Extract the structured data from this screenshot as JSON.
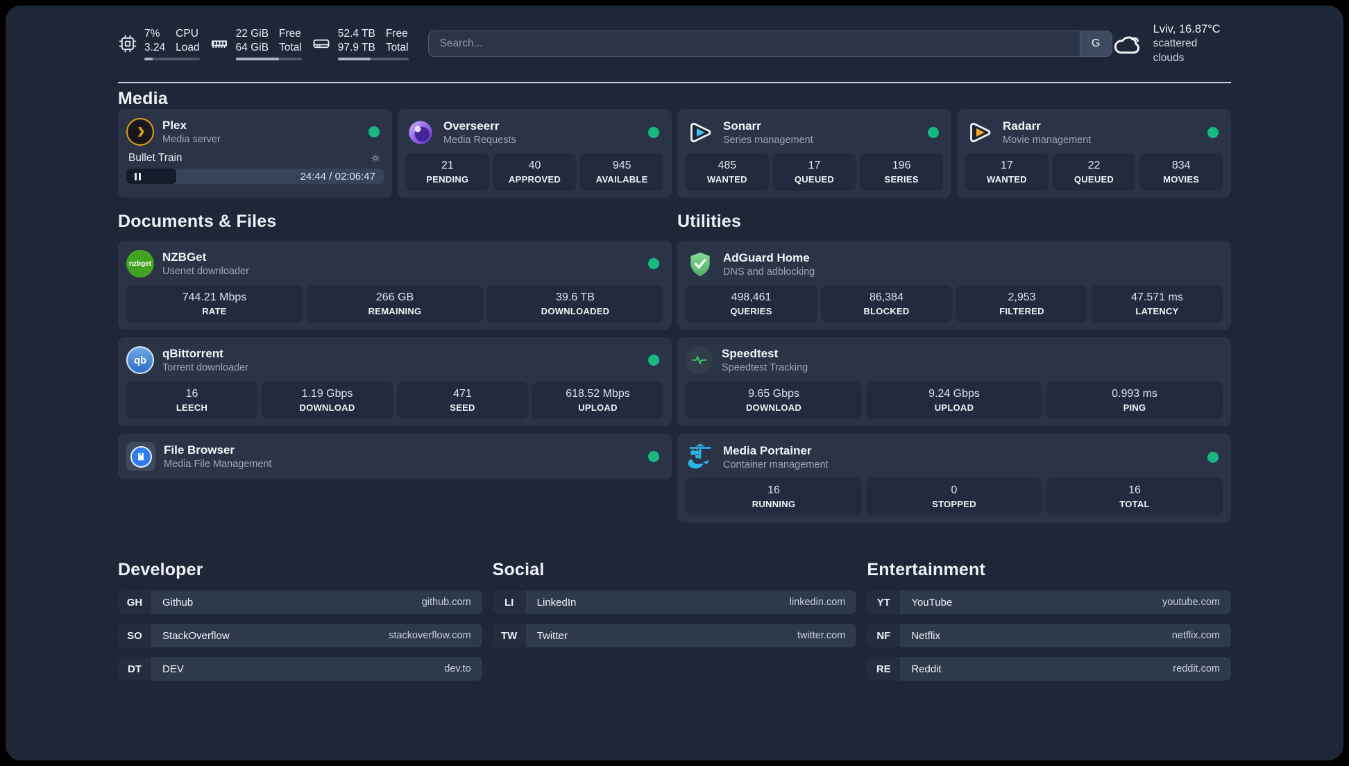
{
  "topbar": {
    "system_stats": [
      {
        "icon": "cpu-icon",
        "values": [
          "7%",
          "3.24"
        ],
        "labels": [
          "CPU",
          "Load"
        ],
        "progress_pct": 15
      },
      {
        "icon": "memory-icon",
        "values": [
          "22 GiB",
          "64 GiB"
        ],
        "labels": [
          "Free",
          "Total"
        ],
        "progress_pct": 66
      },
      {
        "icon": "storage-icon",
        "values": [
          "52.4 TB",
          "97.9 TB"
        ],
        "labels": [
          "Free",
          "Total"
        ],
        "progress_pct": 46
      }
    ],
    "search": {
      "placeholder": "Search...",
      "engine_button_label": "G"
    },
    "weather": {
      "icon": "cloud-icon",
      "location_temperature": "Lviv, 16.87°C",
      "condition": "scattered clouds"
    }
  },
  "media": {
    "heading": "Media",
    "apps": [
      {
        "icon": "plex-icon",
        "name": "Plex",
        "description": "Media server",
        "status": "online",
        "now_playing": {
          "title": "Bullet Train",
          "time": "24:44 / 02:06:47",
          "progress_pct": 19.5
        }
      },
      {
        "icon": "overseerr-icon",
        "name": "Overseerr",
        "description": "Media Requests",
        "status": "online",
        "stats": [
          {
            "value": "21",
            "label": "PENDING"
          },
          {
            "value": "40",
            "label": "APPROVED"
          },
          {
            "value": "945",
            "label": "AVAILABLE"
          }
        ]
      },
      {
        "icon": "sonarr-icon",
        "name": "Sonarr",
        "description": "Series management",
        "status": "online",
        "stats": [
          {
            "value": "485",
            "label": "WANTED"
          },
          {
            "value": "17",
            "label": "QUEUED"
          },
          {
            "value": "196",
            "label": "SERIES"
          }
        ]
      },
      {
        "icon": "radarr-icon",
        "name": "Radarr",
        "description": "Movie management",
        "status": "online",
        "stats": [
          {
            "value": "17",
            "label": "WANTED"
          },
          {
            "value": "22",
            "label": "QUEUED"
          },
          {
            "value": "834",
            "label": "MOVIES"
          }
        ]
      }
    ]
  },
  "documents": {
    "heading": "Documents & Files",
    "apps": [
      {
        "icon": "nzbget-icon",
        "icon_text": "nzbget",
        "name": "NZBGet",
        "description": "Usenet downloader",
        "status": "online",
        "stats": [
          {
            "value": "744.21 Mbps",
            "label": "RATE"
          },
          {
            "value": "266 GB",
            "label": "REMAINING"
          },
          {
            "value": "39.6 TB",
            "label": "DOWNLOADED"
          }
        ]
      },
      {
        "icon": "qbittorrent-icon",
        "icon_text": "qb",
        "name": "qBittorrent",
        "description": "Torrent downloader",
        "status": "online",
        "stats": [
          {
            "value": "16",
            "label": "LEECH"
          },
          {
            "value": "1.19 Gbps",
            "label": "DOWNLOAD"
          },
          {
            "value": "471",
            "label": "SEED"
          },
          {
            "value": "618.52 Mbps",
            "label": "UPLOAD"
          }
        ]
      },
      {
        "icon": "filebrowser-icon",
        "name": "File Browser",
        "description": "Media File Management",
        "status": "online"
      }
    ]
  },
  "utilities": {
    "heading": "Utilities",
    "apps": [
      {
        "icon": "adguard-icon",
        "name": "AdGuard Home",
        "description": "DNS and adblocking",
        "stats": [
          {
            "value": "498,461",
            "label": "QUERIES"
          },
          {
            "value": "86,384",
            "label": "BLOCKED"
          },
          {
            "value": "2,953",
            "label": "FILTERED"
          },
          {
            "value": "47.571 ms",
            "label": "LATENCY"
          }
        ]
      },
      {
        "icon": "speedtest-icon",
        "name": "Speedtest",
        "description": "Speedtest Tracking",
        "stats": [
          {
            "value": "9.65 Gbps",
            "label": "DOWNLOAD"
          },
          {
            "value": "9.24 Gbps",
            "label": "UPLOAD"
          },
          {
            "value": "0.993 ms",
            "label": "PING"
          }
        ]
      },
      {
        "icon": "portainer-icon",
        "name": "Media Portainer",
        "description": "Container management",
        "status": "online",
        "stats": [
          {
            "value": "16",
            "label": "RUNNING"
          },
          {
            "value": "0",
            "label": "STOPPED"
          },
          {
            "value": "16",
            "label": "TOTAL"
          }
        ]
      }
    ]
  },
  "bookmarks": [
    {
      "heading": "Developer",
      "links": [
        {
          "abbr": "GH",
          "name": "Github",
          "url": "github.com"
        },
        {
          "abbr": "SO",
          "name": "StackOverflow",
          "url": "stackoverflow.com"
        },
        {
          "abbr": "DT",
          "name": "DEV",
          "url": "dev.to"
        }
      ]
    },
    {
      "heading": "Social",
      "links": [
        {
          "abbr": "LI",
          "name": "LinkedIn",
          "url": "linkedin.com"
        },
        {
          "abbr": "TW",
          "name": "Twitter",
          "url": "twitter.com"
        }
      ]
    },
    {
      "heading": "Entertainment",
      "links": [
        {
          "abbr": "YT",
          "name": "YouTube",
          "url": "youtube.com"
        },
        {
          "abbr": "NF",
          "name": "Netflix",
          "url": "netflix.com"
        },
        {
          "abbr": "RE",
          "name": "Reddit",
          "url": "reddit.com"
        }
      ]
    }
  ],
  "colors": {
    "status_online": "#16b981",
    "accent_plex": "#e5a00d",
    "accent_sonarr": "#35c5f2",
    "accent_radarr": "#f7a823",
    "page_bg": "#1e2737",
    "card_bg": "#2a3446",
    "tile_bg": "#212b3d"
  }
}
